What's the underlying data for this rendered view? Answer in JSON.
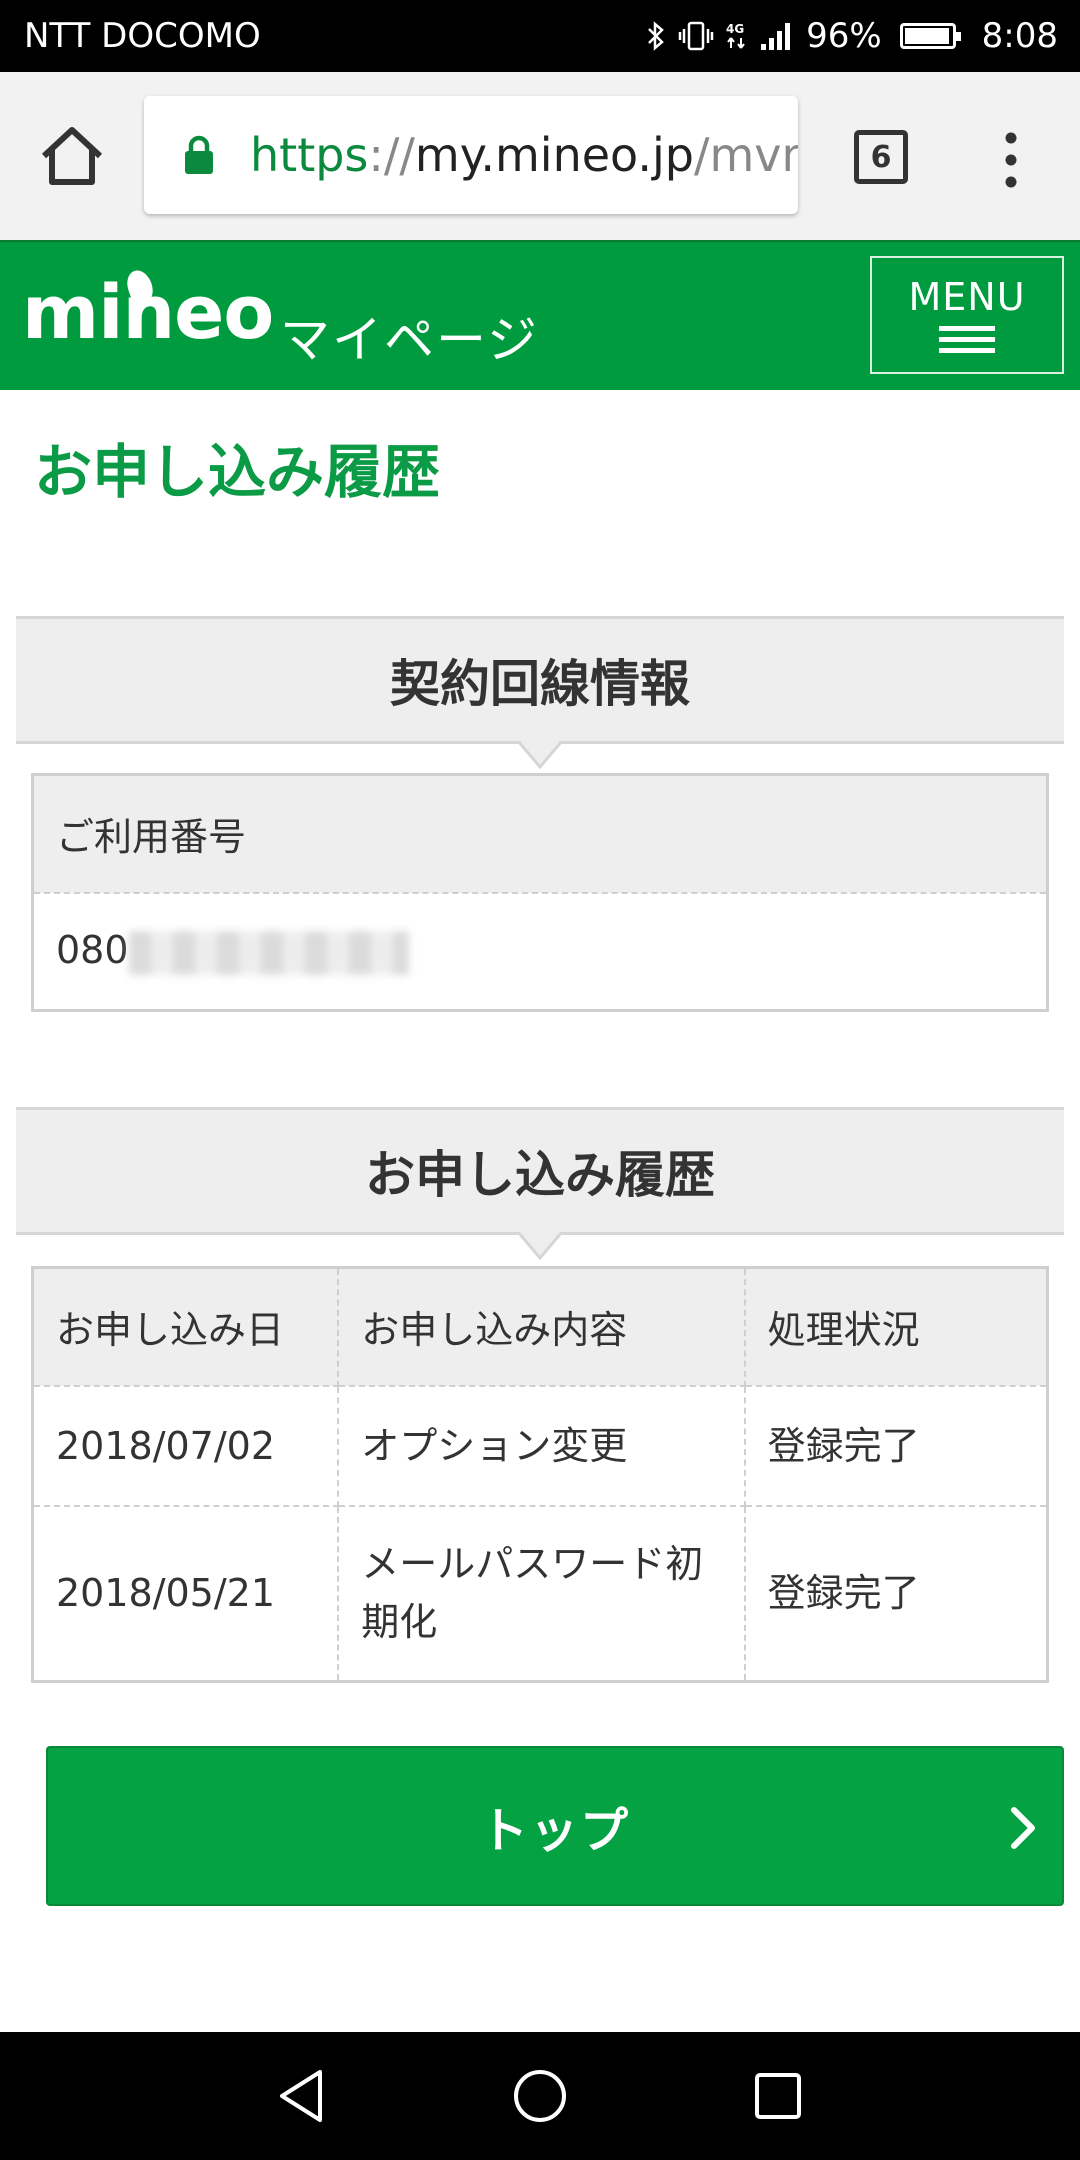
{
  "status_bar": {
    "carrier": "NTT DOCOMO",
    "battery_percent": "96%",
    "battery_level": 0.96,
    "time": "8:08",
    "icons": [
      "bluetooth-icon",
      "vibrate-icon",
      "4g-icon",
      "signal-icon",
      "battery-icon"
    ]
  },
  "browser": {
    "url_scheme": "https",
    "url_sep": "://",
    "url_host": "my.mineo.jp",
    "url_path": "/mvn",
    "tab_count": "6",
    "icons": [
      "home-icon",
      "lock-icon",
      "more-vert-icon"
    ]
  },
  "header": {
    "logo": "mineo",
    "subtitle": "マイページ",
    "menu_label": "MENU",
    "brand_color": "#009b3e"
  },
  "page": {
    "title": "お申し込み履歴"
  },
  "contract_section": {
    "heading": "契約回線情報",
    "column_header": "ご利用番号",
    "number_visible": "080"
  },
  "history_section": {
    "heading": "お申し込み履歴",
    "headers": [
      "お申し込み日",
      "お申し込み内容",
      "処理状況"
    ],
    "rows": [
      [
        "2018/07/02",
        "オプション変更",
        "登録完了"
      ],
      [
        "2018/05/21",
        "メールパスワード初期化",
        "登録完了"
      ]
    ]
  },
  "buttons": {
    "top_label": "トップ"
  },
  "nav_bar": {
    "icons": [
      "back-icon",
      "home-circle-icon",
      "recents-icon"
    ]
  }
}
